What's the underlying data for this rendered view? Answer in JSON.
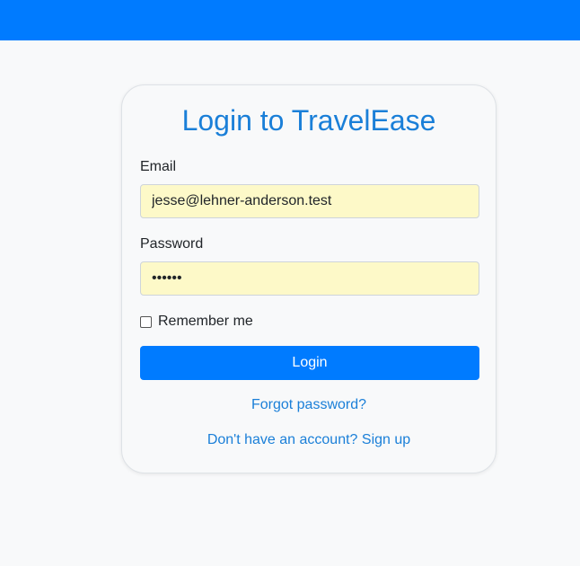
{
  "colors": {
    "topbar": "#007bff",
    "accent": "#1a7fd8",
    "input_autofill_bg": "#fdf9c8",
    "page_bg": "#f8f9fa"
  },
  "login": {
    "title": "Login to TravelEase",
    "email_label": "Email",
    "email_value": "jesse@lehner-anderson.test",
    "password_label": "Password",
    "password_value": "••••••",
    "remember_label": "Remember me",
    "remember_checked": false,
    "login_button": "Login",
    "forgot_link": "Forgot password?",
    "signup_link": "Don't have an account? Sign up"
  }
}
